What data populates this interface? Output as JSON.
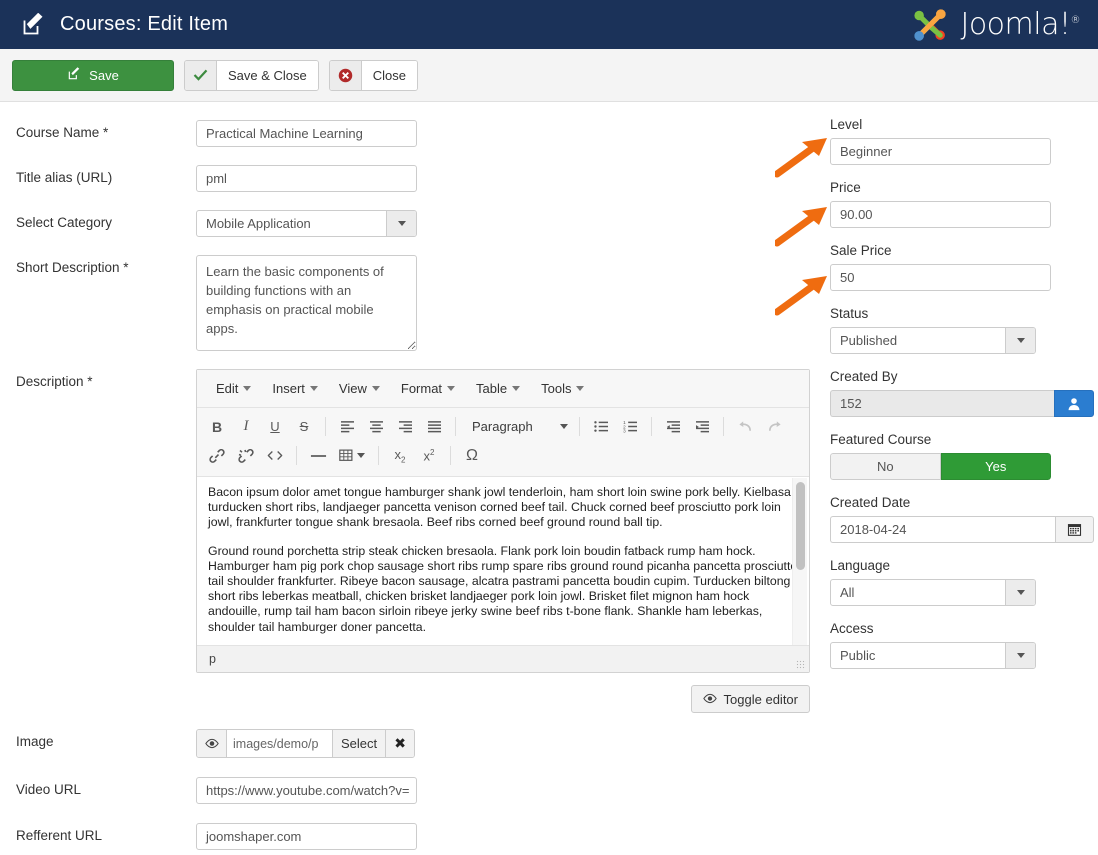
{
  "header": {
    "title": "Courses: Edit Item",
    "icon": "edit-square-icon",
    "brand": "Joomla!",
    "brand_sup": "®",
    "bg_color": "#1b3259"
  },
  "toolbar": {
    "save_label": "Save",
    "save_close_label": "Save & Close",
    "close_label": "Close",
    "save_color": "#3d9140"
  },
  "form": {
    "course_name_label": "Course Name *",
    "course_name_value": "Practical Machine Learning",
    "title_alias_label": "Title alias (URL)",
    "title_alias_value": "pml",
    "select_category_label": "Select Category",
    "select_category_value": "Mobile Application",
    "short_description_label": "Short Description *",
    "short_description_value": "Learn the basic components of building functions with an emphasis on practical mobile apps.",
    "description_label": "Description *",
    "image_label": "Image",
    "image_path": "images/demo/p",
    "image_select_label": "Select",
    "image_clear_label": "✖",
    "video_url_label": "Video URL",
    "video_url_value": "https://www.youtube.com/watch?v=",
    "refferent_url_label": "Refferent URL",
    "refferent_url_value": "joomshaper.com",
    "toggle_editor_label": "Toggle editor"
  },
  "editor": {
    "menus": [
      "Edit",
      "Insert",
      "View",
      "Format",
      "Table",
      "Tools"
    ],
    "format_select": "Paragraph",
    "buttons_row1": [
      "bold",
      "italic",
      "underline",
      "strikethrough",
      "align-left",
      "align-center",
      "align-right",
      "align-justify",
      "bullet-list",
      "numbered-list",
      "outdent",
      "indent",
      "undo",
      "redo"
    ],
    "buttons_row2": [
      "link",
      "unlink",
      "source-code",
      "horizontal-rule",
      "table",
      "subscript",
      "superscript",
      "special-character"
    ],
    "paragraphs": [
      "Bacon ipsum dolor amet tongue hamburger shank jowl tenderloin, ham short loin swine pork belly. Kielbasa turducken short ribs, landjaeger pancetta venison corned beef tail. Chuck corned beef prosciutto pork loin jowl, frankfurter tongue shank bresaola. Beef ribs corned beef ground round ball tip.",
      "Ground round porchetta strip steak chicken bresaola. Flank pork loin boudin fatback rump ham hock. Hamburger ham pig pork chop sausage short ribs rump spare ribs ground round picanha pancetta prosciutto tail shoulder frankfurter. Ribeye bacon sausage, alcatra pastrami pancetta boudin cupim. Turducken biltong short ribs leberkas meatball, chicken brisket landjaeger pork loin jowl. Brisket filet mignon ham hock andouille, rump tail ham bacon sirloin ribeye jerky swine beef ribs t-bone flank. Shankle ham leberkas, shoulder tail hamburger doner pancetta."
    ],
    "status_path": "p"
  },
  "sidebar": {
    "level_label": "Level",
    "level_value": "Beginner",
    "price_label": "Price",
    "price_value": "90.00",
    "sale_price_label": "Sale Price",
    "sale_price_value": "50",
    "status_label": "Status",
    "status_value": "Published",
    "created_by_label": "Created By",
    "created_by_value": "152",
    "featured_label": "Featured Course",
    "featured_no": "No",
    "featured_yes": "Yes",
    "featured_selected": "Yes",
    "created_date_label": "Created Date",
    "created_date_value": "2018-04-24",
    "language_label": "Language",
    "language_value": "All",
    "access_label": "Access",
    "access_value": "Public"
  },
  "annotations": {
    "arrow_color": "#ef6c10",
    "count": 3,
    "targets": [
      "Level",
      "Price",
      "Sale Price"
    ]
  }
}
